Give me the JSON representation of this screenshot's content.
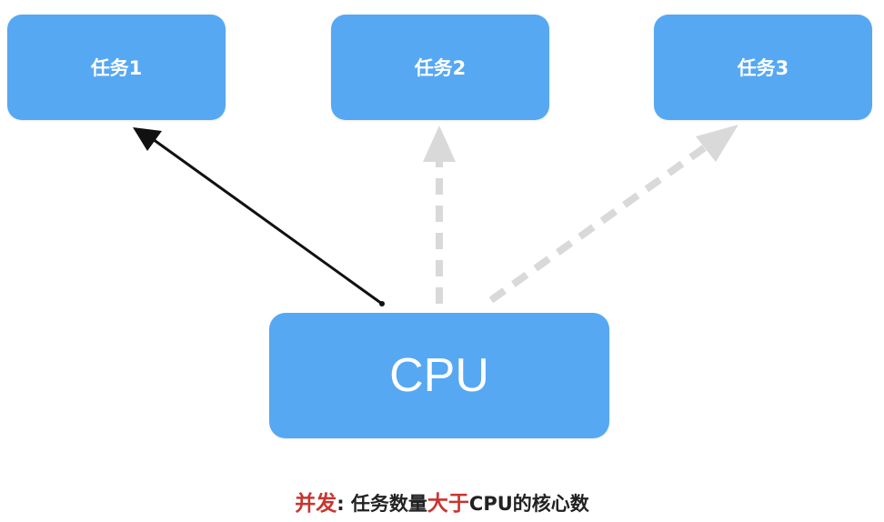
{
  "tasks": [
    {
      "label": "任务1"
    },
    {
      "label": "任务2"
    },
    {
      "label": "任务3"
    }
  ],
  "cpu": {
    "label": "CPU"
  },
  "caption": {
    "term": "并发",
    "colon": ":",
    "part1": "任务数量",
    "emphasis": "大于",
    "part2": "CPU的核心数"
  },
  "colors": {
    "box": "#56a8f2",
    "active_arrow": "#111111",
    "inactive_arrow": "#d9d9d9",
    "highlight_text": "#c9352f"
  }
}
